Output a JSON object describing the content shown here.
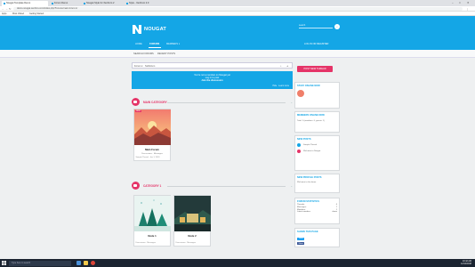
{
  "browser": {
    "tabs": [
      {
        "label": "Nougat Template Demo"
      },
      {
        "label": "Forum Demo"
      },
      {
        "label": "Nougat Style for XenForo 2"
      },
      {
        "label": "Style - XenForo 2.0"
      }
    ],
    "url": "demo.nougat.xenforo.com/index.php?forums/main-forum.1/",
    "bookmarks": [
      "Apps",
      "Most Visited",
      "Getting Started"
    ],
    "window_controls": [
      "–",
      "□",
      "✕"
    ]
  },
  "header": {
    "brand": "NOUGAT",
    "search_label": "search",
    "nav": [
      "HOME",
      "FORUMS",
      "MEMBERS ▾"
    ],
    "login": "LOG IN OR REGISTER"
  },
  "subbar": {
    "crumbs": [
      "SEARCH FORUMS",
      "RECENT POSTS"
    ]
  },
  "search_row": {
    "items": [
      "Forum ▾",
      "Subforum"
    ]
  },
  "notice": {
    "lines": [
      "You're not a member on Nougat yet",
      "Log in to post",
      "Join the discussion"
    ],
    "links": "Hide · Learn more"
  },
  "categories": [
    {
      "title": "MAIN CATEGORY",
      "forums": [
        {
          "name": "Main Forum",
          "sub": "Discussions  ·  Messages",
          "foot": "Sample Thread  ·  Jan 1, 2018",
          "badge": "NEW"
        }
      ]
    },
    {
      "title": "CATEGORY 1",
      "forums": [
        {
          "name": "Node 1",
          "sub": "",
          "foot": "Discussions  ·  Messages"
        },
        {
          "name": "Node 2",
          "sub": "",
          "foot": "Discussions  ·  Messages"
        }
      ]
    }
  ],
  "sidebar": {
    "post_button": "POST NEW THREAD",
    "staff_title": "STAFF ONLINE NOW",
    "members_title": "MEMBERS ONLINE NOW",
    "members_text": "Total: 1 (members: 0, guests: 1)",
    "new_posts_title": "NEW POSTS",
    "new_posts": [
      "Sample Thread",
      "Welcome to Nougat"
    ],
    "new_profile_title": "NEW PROFILE POSTS",
    "new_profile": "Welcome to the demo",
    "stats_title": "FORUM STATISTICS",
    "stats": [
      {
        "label": "Threads:",
        "value": "4"
      },
      {
        "label": "Messages:",
        "value": "7"
      },
      {
        "label": "Members:",
        "value": "1"
      },
      {
        "label": "Latest member:",
        "value": "demo"
      }
    ],
    "share_title": "SHARE THIS PAGE",
    "share_buttons": [
      "Tweet",
      "Share"
    ]
  },
  "taskbar": {
    "search_placeholder": "Type here to search",
    "time": "10:42 AM",
    "date": "12/14/2018"
  },
  "colors": {
    "brand_blue": "#14a6e6",
    "accent_pink": "#e53468"
  }
}
